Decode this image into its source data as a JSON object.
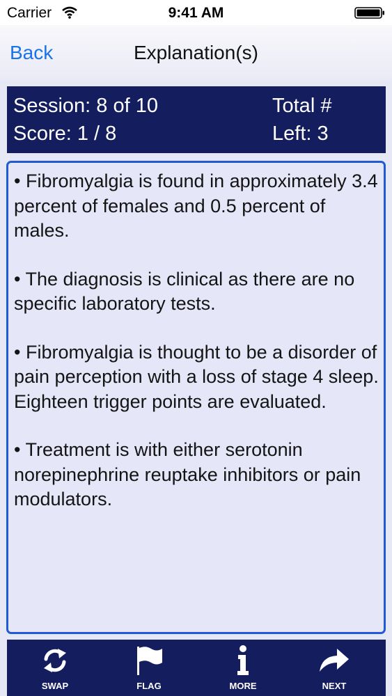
{
  "status_bar": {
    "carrier": "Carrier",
    "time": "9:41 AM"
  },
  "nav": {
    "back_label": "Back",
    "title": "Explanation(s)"
  },
  "session": {
    "session_text": "Session: 8 of 10",
    "score_text": "Score: 1 / 8",
    "total_text": "Total #",
    "left_text": "Left: 3"
  },
  "explanation": {
    "paragraphs": [
      "• Fibromyalgia is found in approximately 3.4 percent of females and 0.5 percent of males.",
      "•  The diagnosis is clinical as there are no specific laboratory tests.",
      "•  Fibromyalgia is thought to be a disorder of pain perception with a loss of stage 4 sleep. Eighteen trigger points are evaluated.",
      "•  Treatment is with either serotonin norepinephrine reuptake inhibitors or pain modulators."
    ]
  },
  "toolbar": {
    "swap_label": "SWAP",
    "flag_label": "FLAG",
    "more_label": "MORE",
    "next_label": "NEXT"
  },
  "colors": {
    "accent_blue": "#1a73e8",
    "navy": "#141d5e",
    "box_border": "#1f5bd6",
    "background": "#e7e8f6"
  },
  "icons": [
    "wifi-icon",
    "battery-icon",
    "swap-icon",
    "flag-icon",
    "info-icon",
    "next-arrow-icon"
  ]
}
